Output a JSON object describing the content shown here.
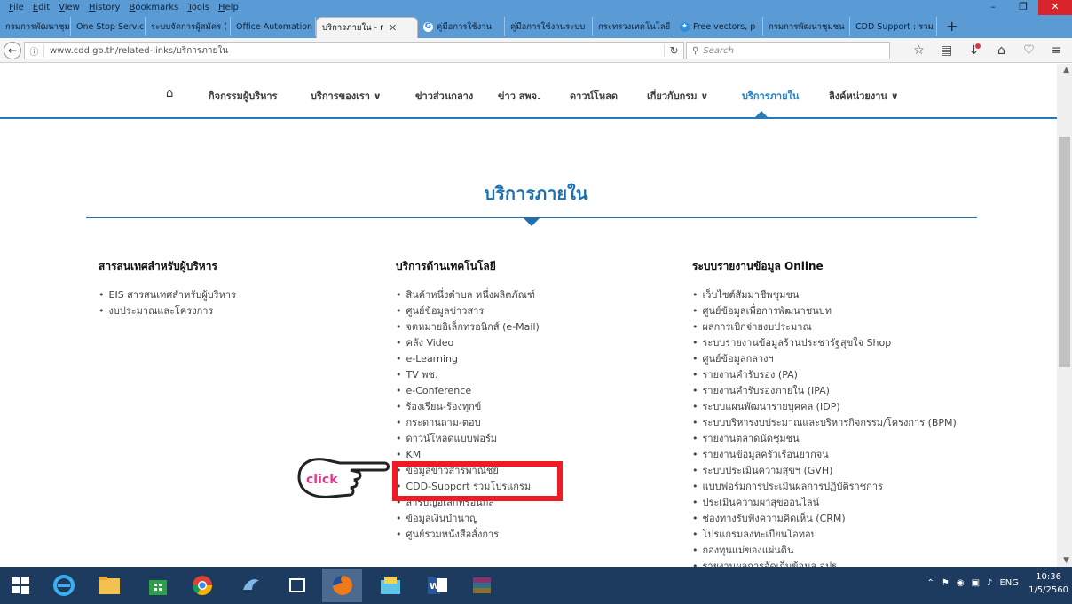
{
  "menubar": {
    "items": [
      "File",
      "Edit",
      "View",
      "History",
      "Bookmarks",
      "Tools",
      "Help"
    ]
  },
  "tabs": [
    {
      "label": "กรมการพัฒนาชุมชน",
      "icon": "page-icon",
      "active": false
    },
    {
      "label": "One Stop Service",
      "icon": "page-icon",
      "active": false
    },
    {
      "label": "ระบบจัดการผู้สมัคร (",
      "icon": "page-icon",
      "active": false
    },
    {
      "label": "Office Automation",
      "icon": "page-icon",
      "active": false
    },
    {
      "label": "บริการภายใน - r",
      "icon": "page-icon",
      "active": true
    },
    {
      "label": "คู่มือการใช้งาน",
      "icon": "google-icon",
      "active": false
    },
    {
      "label": "คู่มือการใช้งานระบบ",
      "icon": "page-icon",
      "active": false
    },
    {
      "label": "กระทรวงเทคโนโลยี",
      "icon": "page-icon",
      "active": false
    },
    {
      "label": "Free vectors, p",
      "icon": "vector-icon",
      "active": false
    },
    {
      "label": "กรมการพัฒนาชุมชน",
      "icon": "page-icon",
      "active": false
    },
    {
      "label": "CDD Support : รวม",
      "icon": "page-icon",
      "active": false
    }
  ],
  "navbar": {
    "url": "www.cdd.go.th/related-links/บริการภายใน",
    "search_placeholder": "Search"
  },
  "site_nav": {
    "items": [
      {
        "label": "กิจกรรมผู้บริหาร",
        "active": false
      },
      {
        "label": "บริการของเรา ∨",
        "active": false
      },
      {
        "label": "ข่าวส่วนกลาง",
        "active": false
      },
      {
        "label": "ข่าว สพจ.",
        "active": false
      },
      {
        "label": "ดาวน์โหลด",
        "active": false
      },
      {
        "label": "เกี่ยวกับกรม ∨",
        "active": false
      },
      {
        "label": "บริการภายใน",
        "active": true
      },
      {
        "label": "ลิงค์หน่วยงาน ∨",
        "active": false
      }
    ]
  },
  "page": {
    "title": "บริการภายใน",
    "columns": [
      {
        "title": "สารสนเทศสำหรับผู้บริหาร",
        "items": [
          "EIS สารสนเทศสำหรับผู้บริหาร",
          "งบประมาณและโครงการ"
        ]
      },
      {
        "title": "บริการด้านเทคโนโลยี",
        "items": [
          "สินค้าหนึ่งตำบล หนึ่งผลิตภัณฑ์",
          "ศูนย์ข้อมูลข่าวสาร",
          "จดหมายอิเล็กทรอนิกส์ (e-Mail)",
          "คลัง Video",
          "e-Learning",
          "TV พช.",
          "e-Conference",
          "ร้องเรียน-ร้องทุกข์",
          "กระดานถาม-ตอบ",
          "ดาวน์โหลดแบบฟอร์ม",
          "KM",
          "ข้อมูลข่าวสารพาณิชย์",
          "CDD-Support รวมโปรแกรม",
          "สารบัญอิเล็กทรอนิกส์",
          "ข้อมูลเงินบำนาญ",
          "ศูนย์รวมหนังสือสั่งการ"
        ]
      },
      {
        "title": "ระบบรายงานข้อมูล Online",
        "items": [
          "เว็บไซต์สัมมาชีพชุมชน",
          "ศูนย์ข้อมูลเพื่อการพัฒนาชนบท",
          "ผลการเบิกจ่ายงบประมาณ",
          "ระบบรายงานข้อมูลร้านประชารัฐสุขใจ Shop",
          "ศูนย์ข้อมูลกลางฯ",
          "รายงานคำรับรอง (PA)",
          "รายงานคำรับรองภายใน (IPA)",
          "ระบบแผนพัฒนารายบุคคล (IDP)",
          "ระบบบริหารงบประมาณและบริหารกิจกรรม/โครงการ (BPM)",
          "รายงานตลาดนัดชุมชน",
          "รายงานข้อมูลครัวเรือนยากจน",
          "ระบบประเมินความสุขฯ (GVH)",
          "แบบฟอร์มการประเมินผลการปฏิบัติราชการ",
          "ประเมินความผาสุขออนไลน์",
          "ช่องทางรับฟังความคิดเห็น (CRM)",
          "โปรแกรมลงทะเบียนโอทอป",
          "กองทุนแม่ของแผ่นดิน",
          "รายงานผลการจัดเก็บข้อมูล จปฐ"
        ]
      }
    ]
  },
  "annotation": {
    "click_label": "click",
    "highlight_color": "#ee1b24"
  },
  "taskbar": {
    "lang": "ENG",
    "time": "10:36",
    "date": "1/5/2560"
  },
  "colors": {
    "chrome_blue": "#5b9bd5",
    "site_accent": "#1d6fb0",
    "taskbar": "#1d3a5f"
  }
}
